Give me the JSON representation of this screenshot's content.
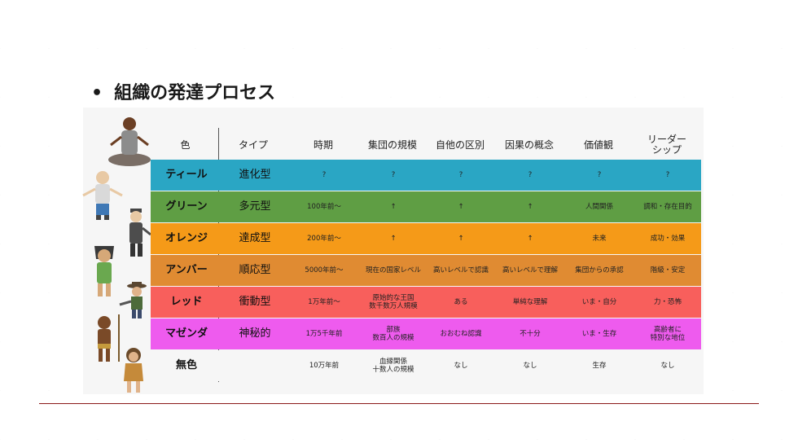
{
  "slide": {
    "bullet": "•",
    "title": "組織の発達プロセス"
  },
  "table": {
    "headers": [
      "色",
      "タイプ",
      "時期",
      "集団の規模",
      "自他の区別",
      "因果の概念",
      "価値観",
      "リーダーシップ"
    ],
    "header_last_lines": [
      "リーダー",
      "シップ"
    ],
    "rows": [
      {
        "color": "ティール",
        "type": "進化型",
        "era": "?",
        "scale": "?",
        "self_other": "?",
        "causality": "?",
        "values": "?",
        "leadership": "?",
        "bg": "#2aa6c4"
      },
      {
        "color": "グリーン",
        "type": "多元型",
        "era": "100年前～",
        "scale": "↑",
        "self_other": "↑",
        "causality": "↑",
        "values": "人間関係",
        "leadership": "調和・存在目的",
        "bg": "#5f9e44"
      },
      {
        "color": "オレンジ",
        "type": "達成型",
        "era": "200年前～",
        "scale": "↑",
        "self_other": "↑",
        "causality": "↑",
        "values": "未来",
        "leadership": "成功・効果",
        "bg": "#f59a18"
      },
      {
        "color": "アンバー",
        "type": "順応型",
        "era": "5000年前～",
        "scale": "現在の国家レベル",
        "self_other": "高いレベルで認識",
        "causality": "高いレベルで理解",
        "values": "集団からの承認",
        "leadership": "階級・安定",
        "bg": "#e08b32"
      },
      {
        "color": "レッド",
        "type": "衝動型",
        "era": "1万年前～",
        "scale": "原始的な王国 数千数万人規模",
        "self_other": "ある",
        "causality": "単純な理解",
        "values": "いま・自分",
        "leadership": "力・恐怖",
        "bg": "#f85f5c"
      },
      {
        "color": "マゼンダ",
        "type": "神秘的",
        "era": "1万5千年前",
        "scale": "部族 数百人の規模",
        "self_other": "おおむね認識",
        "causality": "不十分",
        "values": "いま・生存",
        "leadership": "高齢者に 特別な地位",
        "bg": "#ee5bee"
      },
      {
        "color": "無色",
        "type": "",
        "era": "10万年前",
        "scale": "血縁関係 十数人の規模",
        "self_other": "なし",
        "causality": "なし",
        "values": "生存",
        "leadership": "なし",
        "bg": "#f6f6f6"
      }
    ],
    "multiline": {
      "red_scale": [
        "原始的な王国",
        "数千数万人規模"
      ],
      "magenta_scale": [
        "部族",
        "数百人の規模"
      ],
      "magenta_leadership": [
        "高齢者に",
        "特別な地位"
      ],
      "none_scale": [
        "血縁関係",
        "十数人の規模"
      ]
    }
  },
  "figures": [
    "meditating-sage-figure",
    "green-shirt-man-figure",
    "businessman-figure",
    "pharaoh-figure",
    "cowboy-figure",
    "tribal-hunter-figure",
    "cave-woman-figure"
  ],
  "colors": {
    "separator": "#8b1a1a"
  }
}
